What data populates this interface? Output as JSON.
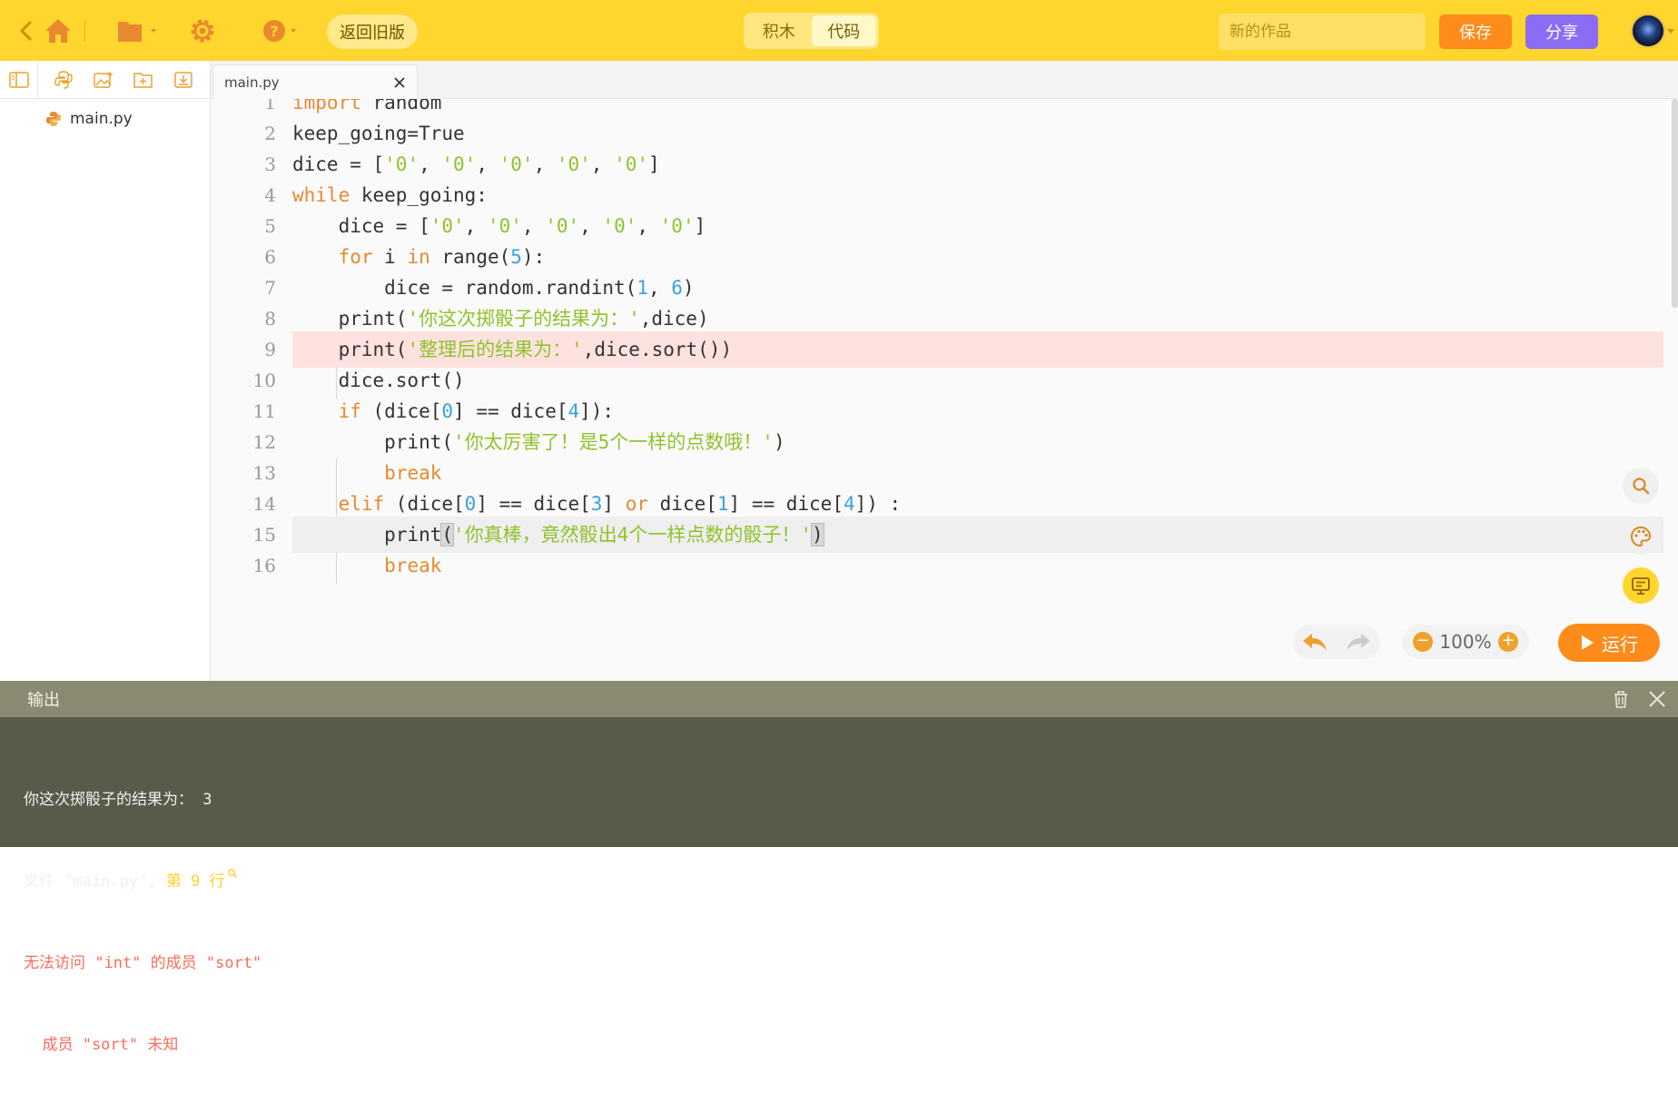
{
  "topbar": {
    "old_version_label": "返回旧版",
    "mode_blocks": "积木",
    "mode_code": "代码",
    "title_placeholder": "新的作品",
    "save_label": "保存",
    "share_label": "分享"
  },
  "sidebar": {
    "file_name": "main.py"
  },
  "editor": {
    "tab_name": "main.py",
    "line_numbers": [
      "1",
      "2",
      "3",
      "4",
      "5",
      "6",
      "7",
      "8",
      "9",
      "10",
      "11",
      "12",
      "13",
      "14",
      "15",
      "16"
    ],
    "line1": [
      "import",
      " random"
    ],
    "line2": [
      "keep_going=True"
    ],
    "line3": [
      "dice = [",
      "'0'",
      ", ",
      "'0'",
      ", ",
      "'0'",
      ", ",
      "'0'",
      ", ",
      "'0'",
      "]"
    ],
    "line4": [
      "while",
      " keep_going:"
    ],
    "line5": [
      "    dice = [",
      "'0'",
      ", ",
      "'0'",
      ", ",
      "'0'",
      ", ",
      "'0'",
      ", ",
      "'0'",
      "]"
    ],
    "line6": [
      "    ",
      "for",
      " i ",
      "in",
      " range(",
      "5",
      "):"
    ],
    "line7": [
      "        dice = random.randint(",
      "1",
      ", ",
      "6",
      ")"
    ],
    "line8": [
      "    print(",
      "'你这次掷骰子的结果为：'",
      ",dice)"
    ],
    "line9": [
      "    print(",
      "'整理后的结果为：'",
      ",dice.sort())"
    ],
    "line10": [
      "    dice.sort()"
    ],
    "line11": [
      "    ",
      "if",
      " (dice[",
      "0",
      "] == dice[",
      "4",
      "]):"
    ],
    "line12": [
      "        print(",
      "'你太厉害了！是5个一样的点数哦！'",
      ")"
    ],
    "line13": [
      "        ",
      "break"
    ],
    "line14": [
      "    ",
      "elif",
      " (dice[",
      "0",
      "] == dice[",
      "3",
      "] ",
      "or",
      " dice[",
      "1",
      "] == dice[",
      "4",
      "]) :"
    ],
    "line15": [
      "        print",
      "(",
      "'你真棒，竟然骰出4个一样点数的骰子！'",
      ")"
    ],
    "line16": [
      "        ",
      "break"
    ]
  },
  "controls": {
    "zoom": "100%",
    "run_label": "运行"
  },
  "output": {
    "title": "输出",
    "line1": "你这次掷骰子的结果为： 3",
    "line2_a": "文件 \"main.py\", ",
    "line2_b": "第 9 行",
    "line3": "无法访问 \"int\" 的成员 \"sort\"",
    "line4": "  成员 \"sort\" 未知"
  },
  "colors": {
    "topbar": "#ffd62e",
    "keyword": "#e8892f",
    "string": "#8fc32b",
    "number": "#3ba0e8",
    "error_line": "#fde2df",
    "output_bg": "#5a5a4a"
  }
}
